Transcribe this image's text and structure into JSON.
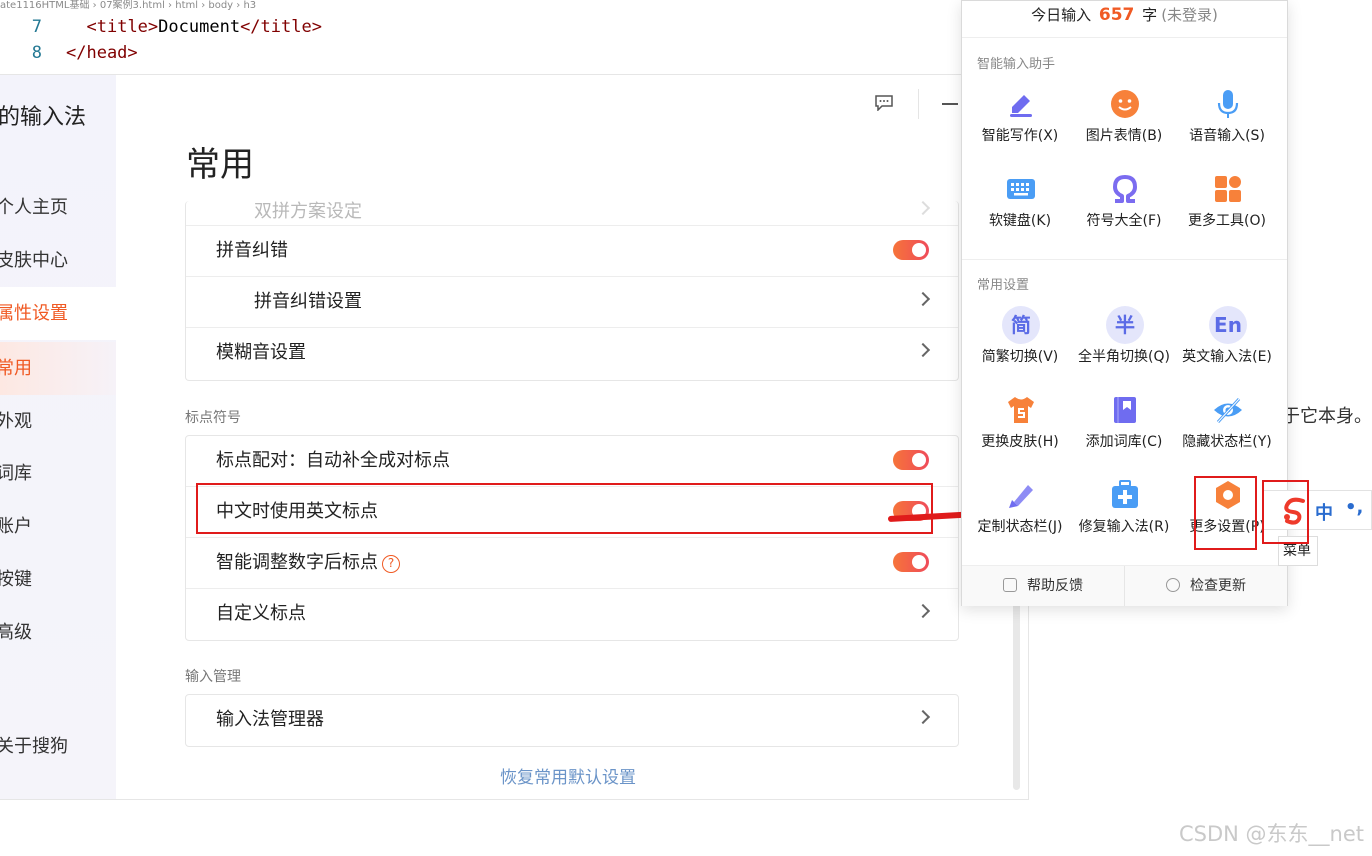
{
  "editor": {
    "crumbs": "ate1116HTML基础 › 07案例3.html › html › body › h3",
    "lines": [
      {
        "num": "7",
        "open": "<",
        "tag": "title",
        "close": ">",
        "text": "Document",
        "end_open": "</",
        "end_tag": "title",
        "end_close": ">"
      },
      {
        "num": "8",
        "text": "</head>"
      }
    ]
  },
  "background": {
    "page_text": "于它本身。",
    "watermark": "CSDN @东东__net"
  },
  "settings": {
    "app_title": "的输入法",
    "nav": [
      {
        "label": "个人主页"
      },
      {
        "label": "皮肤中心"
      },
      {
        "label": "属性设置"
      },
      {
        "label": "常用"
      },
      {
        "label": "外观"
      },
      {
        "label": "词库"
      },
      {
        "label": "账户"
      },
      {
        "label": "按键"
      },
      {
        "label": "高级"
      },
      {
        "label": "关于搜狗"
      }
    ],
    "heading": "常用",
    "card1": {
      "rows": [
        {
          "label": "双拼方案设定"
        },
        {
          "label": "拼音纠错",
          "toggle": true
        },
        {
          "label": "拼音纠错设置"
        },
        {
          "label": "模糊音设置"
        }
      ]
    },
    "section_punctuation": "标点符号",
    "card2": {
      "rows": [
        {
          "label": "标点配对：自动补全成对标点",
          "toggle": true
        },
        {
          "label": "中文时使用英文标点",
          "toggle": true
        },
        {
          "label": "智能调整数字后标点",
          "help": "?",
          "toggle": true
        },
        {
          "label": "自定义标点"
        }
      ]
    },
    "section_input": "输入管理",
    "card3": {
      "rows": [
        {
          "label": "输入法管理器"
        }
      ]
    },
    "restore": "恢复常用默认设置"
  },
  "popup": {
    "header_prefix": "今日输入",
    "count": "657",
    "header_unit": "字",
    "header_status": "(未登录)",
    "section_assist": "智能输入助手",
    "section_common": "常用设置",
    "tools": [
      {
        "label": "智能写作(X)",
        "icon": "pen-icon"
      },
      {
        "label": "图片表情(B)",
        "icon": "smiley-icon"
      },
      {
        "label": "语音输入(S)",
        "icon": "microphone-icon"
      },
      {
        "label": "软键盘(K)",
        "icon": "keyboard-icon"
      },
      {
        "label": "符号大全(F)",
        "icon": "omega-icon"
      },
      {
        "label": "更多工具(O)",
        "icon": "grid-icon"
      }
    ],
    "settings": [
      {
        "label": "简繁切换(V)",
        "glyph": "简"
      },
      {
        "label": "全半角切换(Q)",
        "glyph": "半"
      },
      {
        "label": "英文输入法(E)",
        "glyph": "En"
      },
      {
        "label": "更换皮肤(H)",
        "icon": "tshirt-icon"
      },
      {
        "label": "添加词库(C)",
        "icon": "book-icon"
      },
      {
        "label": "隐藏状态栏(Y)",
        "icon": "eye-off-icon"
      },
      {
        "label": "定制状态栏(J)",
        "icon": "brush-icon"
      },
      {
        "label": "修复输入法(R)",
        "icon": "repair-kit-icon"
      },
      {
        "label": "更多设置(P)",
        "icon": "hex-gear-icon"
      }
    ],
    "footer": {
      "feedback": "帮助反馈",
      "update": "检查更新"
    }
  },
  "statusbar": {
    "mode": "中",
    "punct": "•,",
    "tooltip": "菜单"
  },
  "colors": {
    "accent": "#f05a24",
    "annotation_red": "#e01b1b",
    "link": "#6b94c8"
  }
}
